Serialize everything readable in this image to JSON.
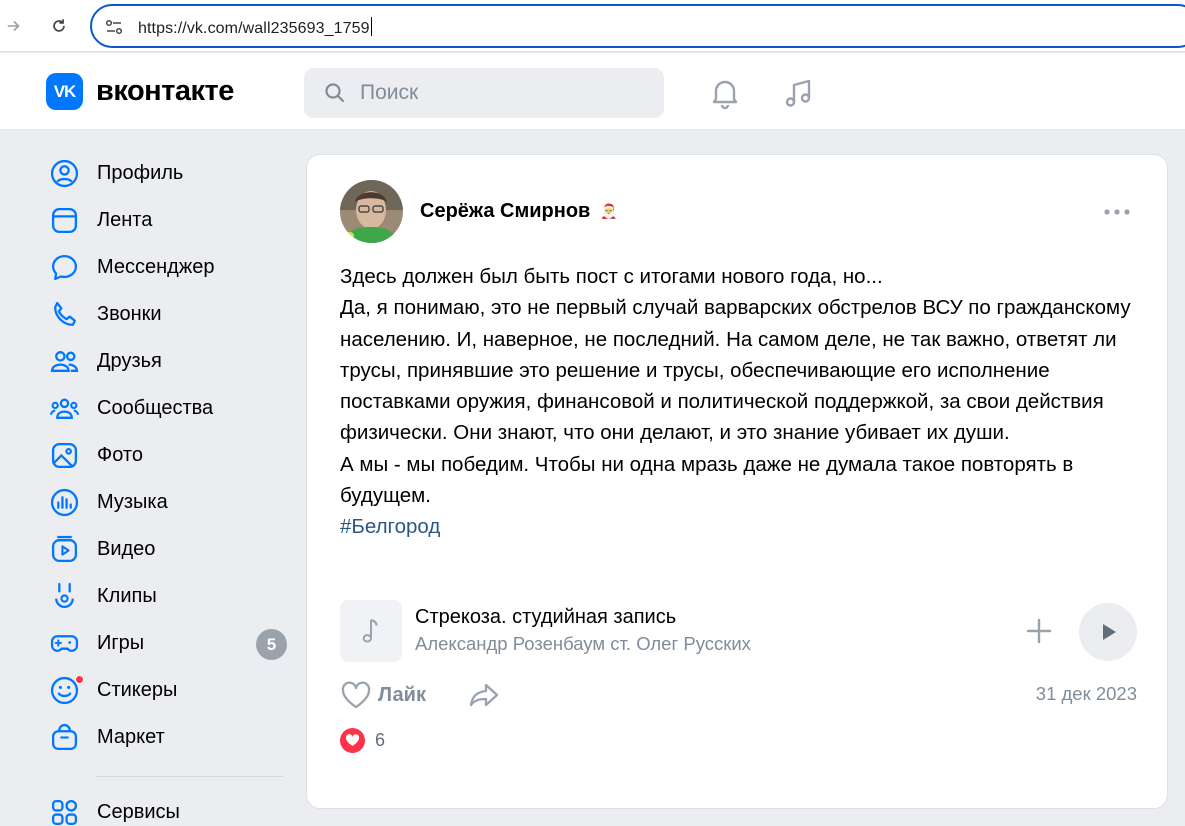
{
  "browser": {
    "url": "https://vk.com/wall235693_1759"
  },
  "header": {
    "logo_badge": "VK",
    "logo_text": "вконтакте",
    "search_placeholder": "Поиск"
  },
  "sidebar": {
    "items": [
      {
        "label": "Профиль",
        "icon": "profile-icon"
      },
      {
        "label": "Лента",
        "icon": "feed-icon"
      },
      {
        "label": "Мессенджер",
        "icon": "messenger-icon"
      },
      {
        "label": "Звонки",
        "icon": "phone-icon"
      },
      {
        "label": "Друзья",
        "icon": "friends-icon"
      },
      {
        "label": "Сообщества",
        "icon": "communities-icon"
      },
      {
        "label": "Фото",
        "icon": "photo-icon"
      },
      {
        "label": "Музыка",
        "icon": "music-icon"
      },
      {
        "label": "Видео",
        "icon": "video-icon"
      },
      {
        "label": "Клипы",
        "icon": "clips-icon"
      },
      {
        "label": "Игры",
        "icon": "games-icon",
        "badge": "5"
      },
      {
        "label": "Стикеры",
        "icon": "stickers-icon"
      },
      {
        "label": "Маркет",
        "icon": "market-icon"
      },
      {
        "label": "Сервисы",
        "icon": "services-icon"
      }
    ]
  },
  "post": {
    "author": "Серёжа Смирнов",
    "author_emoji": "🎅",
    "text_lines": [
      "Здесь должен был быть пост с итогами нового года, но...",
      "Да, я понимаю, это не первый случай варварских обстрелов ВСУ по гражданскому населению. И, наверное, не последний. На самом деле, не так важно, ответят ли трусы, принявшие это решение и трусы, обеспечивающие его исполнение поставками оружия, финансовой и политической поддержкой, за свои действия физически. Они знают, что они делают, и это знание убивает их души.",
      "А мы - мы победим. Чтобы ни одна мразь даже не думала такое повторять в будущем."
    ],
    "hashtag": "#Белгород",
    "audio": {
      "title": "Стрекоза. студийная запись",
      "artist": "Александр Розенбаум ст. Олег Русских"
    },
    "like_label": "Лайк",
    "date": "31 дек 2023",
    "reactions_count": "6"
  },
  "colors": {
    "accent": "#0077ff",
    "link": "#2a5885",
    "muted": "#818c99",
    "badge": "#99a2ad",
    "heart": "#ff3347"
  }
}
